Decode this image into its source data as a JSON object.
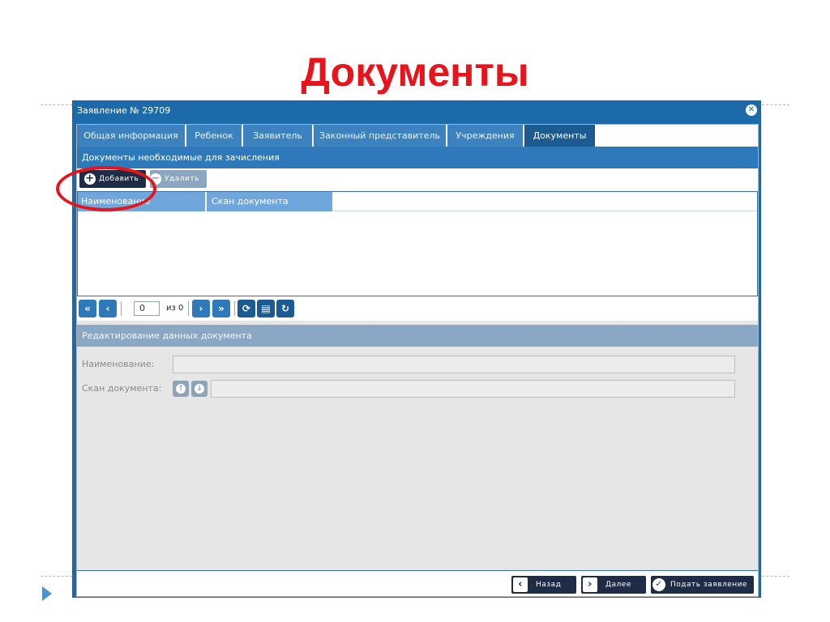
{
  "slide": {
    "title": "Документы"
  },
  "window": {
    "title": "Заявление № 29709"
  },
  "tabs": [
    {
      "label": "Общая информация"
    },
    {
      "label": "Ребенок"
    },
    {
      "label": "Заявитель"
    },
    {
      "label": "Законный представитель"
    },
    {
      "label": "Учреждения"
    },
    {
      "label": "Документы"
    }
  ],
  "active_tab": "Документы",
  "section": {
    "title": "Документы необходимые для зачисления"
  },
  "toolbar": {
    "add_label": "Добавить",
    "delete_label": "Удалить"
  },
  "grid": {
    "columns": [
      {
        "label": "Наименование"
      },
      {
        "label": "Скан документа"
      }
    ],
    "rows": []
  },
  "pager": {
    "page_value": "0",
    "of_label": "из 0"
  },
  "edit": {
    "title": "Редактирование данных документа",
    "name_label": "Наименование:",
    "scan_label": "Скан документа:"
  },
  "footer": {
    "back_label": "Назад",
    "next_label": "Далее",
    "submit_label": "Подать заявление"
  },
  "colors": {
    "title_red": "#e8141c",
    "window_blue": "#1c6aa8",
    "tab_blue": "#3b82bf",
    "active_tab": "#1b5b91",
    "dark_button": "#1e2d45"
  }
}
